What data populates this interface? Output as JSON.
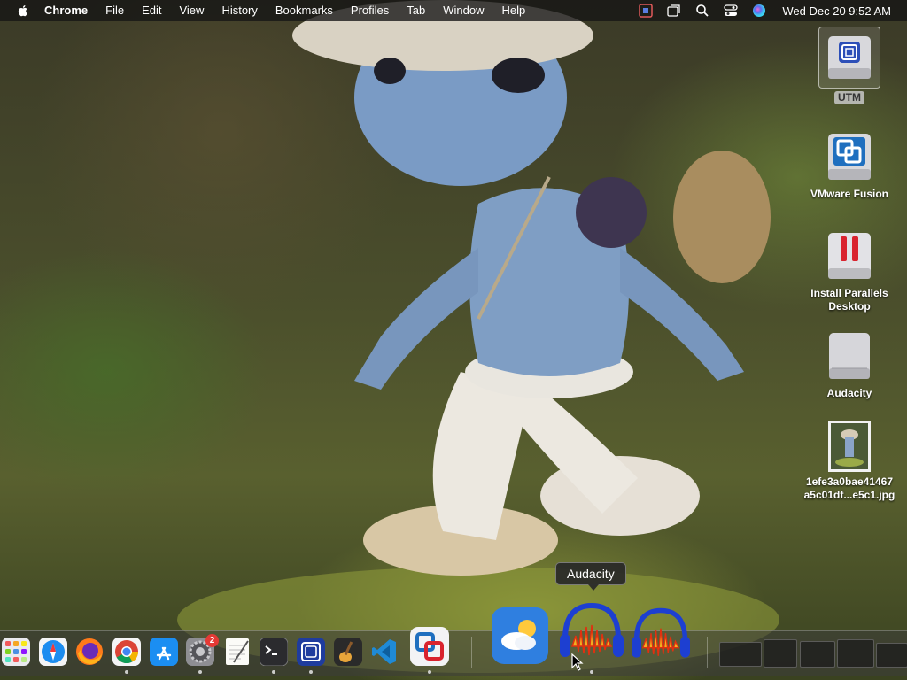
{
  "menubar": {
    "app_name": "Chrome",
    "menus": [
      "File",
      "Edit",
      "View",
      "History",
      "Bookmarks",
      "Profiles",
      "Tab",
      "Window",
      "Help"
    ],
    "clock": "Wed Dec 20  9:52 AM"
  },
  "desktop": {
    "icons": [
      {
        "label": "UTM",
        "icon": "utm-disk-icon",
        "selected": true
      },
      {
        "label": "VMware Fusion",
        "icon": "vmware-fusion-icon"
      },
      {
        "label": "Install Parallels Desktop",
        "icon": "parallels-installer-icon"
      },
      {
        "label": "Audacity",
        "icon": "disk-image-icon"
      },
      {
        "label": "1efe3a0bae41467\na5c01df...e5c1.jpg",
        "icon": "image-file-icon"
      }
    ]
  },
  "tooltip": {
    "text": "Audacity"
  },
  "dock": {
    "apps": [
      {
        "name": "Launchpad",
        "icon": "launchpad-icon"
      },
      {
        "name": "Safari",
        "icon": "safari-icon"
      },
      {
        "name": "Firefox",
        "icon": "firefox-icon"
      },
      {
        "name": "Google Chrome",
        "icon": "chrome-icon",
        "running": true
      },
      {
        "name": "App Store",
        "icon": "app-store-icon"
      },
      {
        "name": "System Settings",
        "icon": "system-settings-icon",
        "badge": "2",
        "running": true
      },
      {
        "name": "TextEdit",
        "icon": "textedit-icon"
      },
      {
        "name": "Terminal",
        "icon": "terminal-icon",
        "running": true
      },
      {
        "name": "UTM",
        "icon": "utm-icon",
        "running": true
      },
      {
        "name": "GarageBand",
        "icon": "garageband-icon"
      },
      {
        "name": "Visual Studio Code",
        "icon": "vscode-icon"
      },
      {
        "name": "VMware Fusion",
        "icon": "vmware-fusion-icon",
        "running": true
      },
      {
        "name": "Weather",
        "icon": "weather-icon"
      },
      {
        "name": "Audacity",
        "icon": "audacity-icon",
        "running": true
      },
      {
        "name": "Audacity",
        "icon": "audacity-icon"
      }
    ]
  },
  "colors": {
    "menubar_bg": "#141414",
    "badge_red": "#e53935",
    "audacity_blue": "#1d3fd1"
  }
}
